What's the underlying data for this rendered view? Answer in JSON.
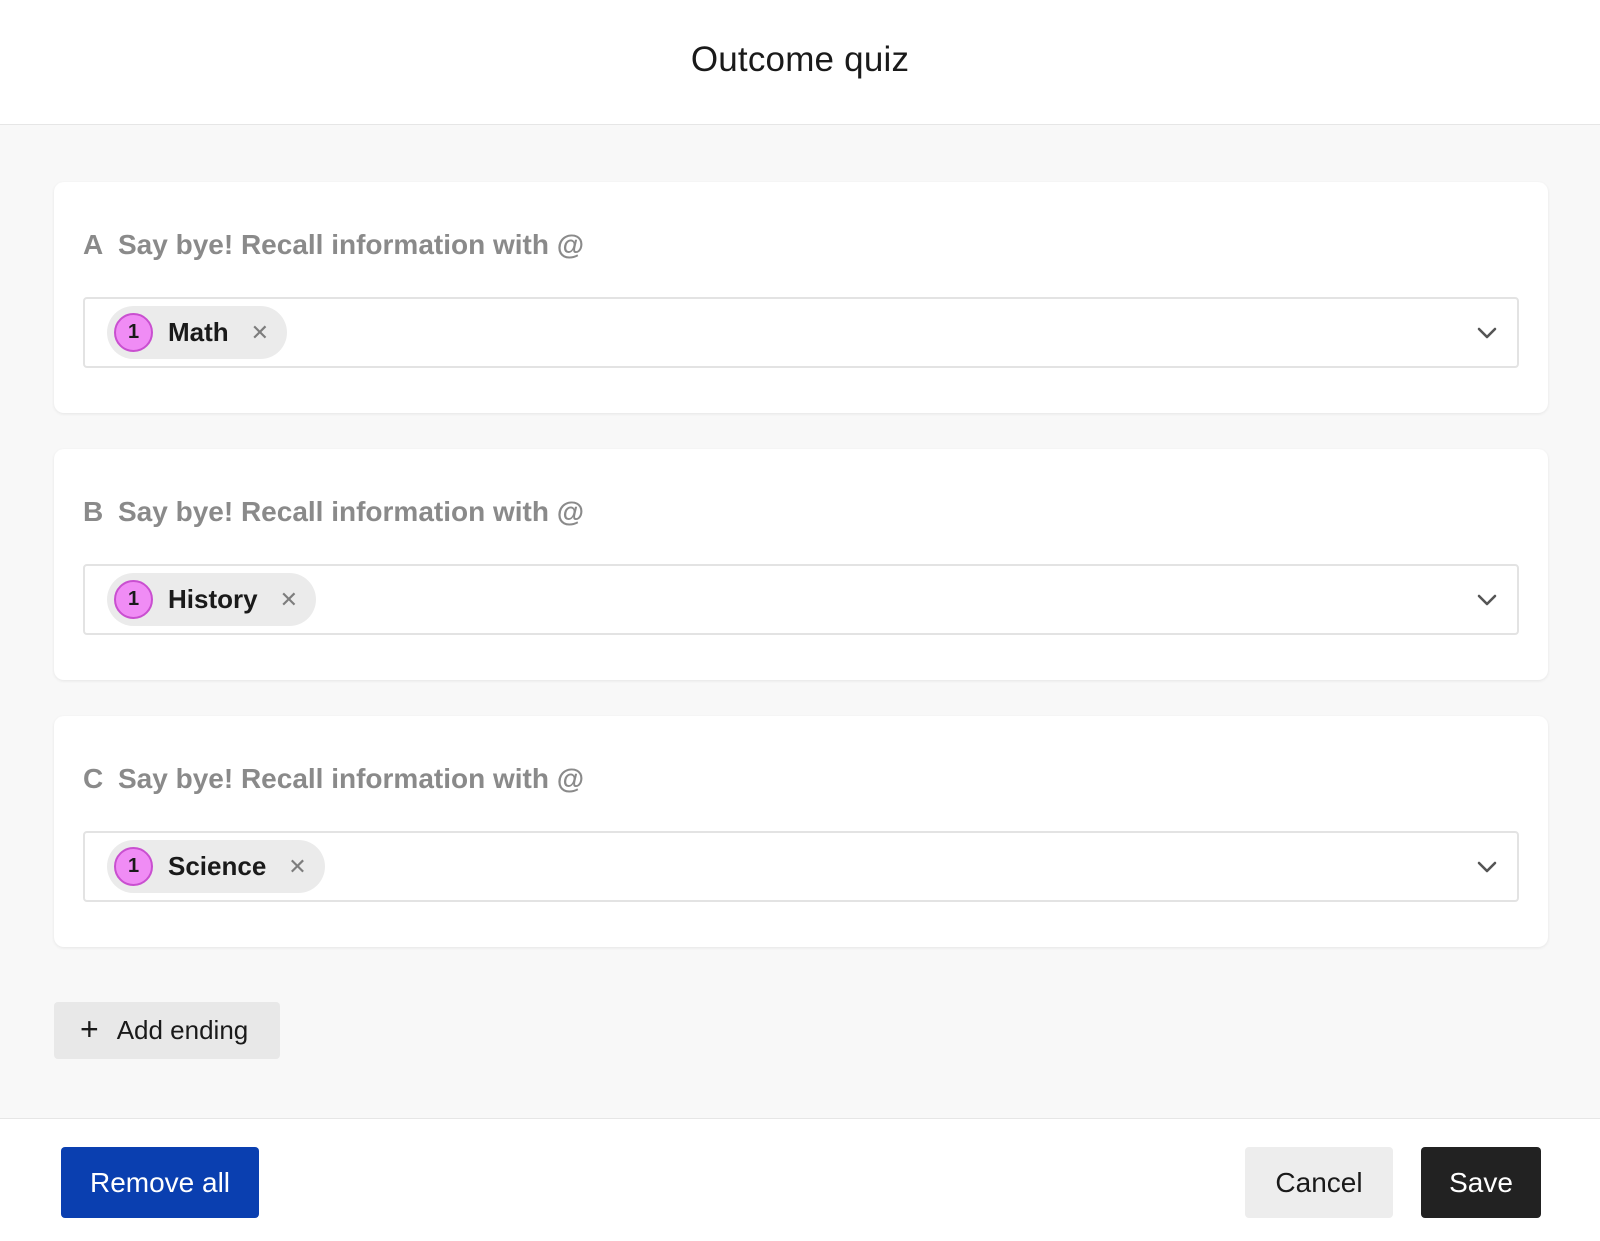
{
  "modal": {
    "title": "Outcome quiz"
  },
  "endings": [
    {
      "letter": "A",
      "prompt": "Say bye! Recall information with @",
      "chip": {
        "count": "1",
        "label": "Math"
      }
    },
    {
      "letter": "B",
      "prompt": "Say bye! Recall information with @",
      "chip": {
        "count": "1",
        "label": "History"
      }
    },
    {
      "letter": "C",
      "prompt": "Say bye! Recall information with @",
      "chip": {
        "count": "1",
        "label": "Science"
      }
    }
  ],
  "add_ending": {
    "icon": "plus-icon",
    "label": "Add ending"
  },
  "footer": {
    "remove_all_label": "Remove all",
    "cancel_label": "Cancel",
    "save_label": "Save"
  },
  "colors": {
    "primary": "#0a3fb0",
    "dark_button": "#222222",
    "chip_badge": "#f08cf5",
    "chip_badge_border": "#c94fd0"
  }
}
